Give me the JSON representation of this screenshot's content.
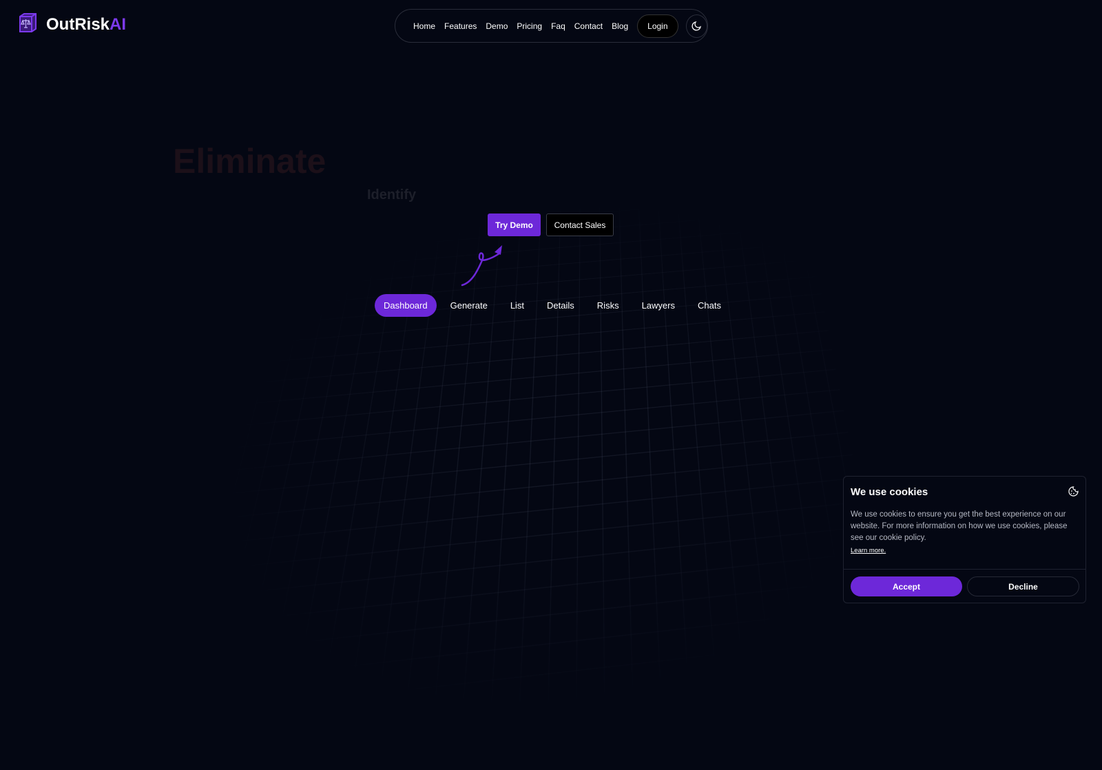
{
  "brand": {
    "name": "OutRisk",
    "accent": "AI"
  },
  "nav": {
    "items": [
      "Home",
      "Features",
      "Demo",
      "Pricing",
      "Faq",
      "Contact",
      "Blog"
    ],
    "login": "Login"
  },
  "hero": {
    "headline": "Eliminate",
    "subheadline": "Identify",
    "try_demo": "Try Demo",
    "contact_sales": "Contact Sales"
  },
  "tabs": [
    "Dashboard",
    "Generate",
    "List",
    "Details",
    "Risks",
    "Lawyers",
    "Chats"
  ],
  "cookie": {
    "title": "We use cookies",
    "body": "We use cookies to ensure you get the best experience on our website. For more information on how we use cookies, please see our cookie policy.",
    "learn_more": "Learn more.",
    "accept": "Accept",
    "decline": "Decline"
  },
  "colors": {
    "accent": "#6d28d9",
    "background": "#040713"
  }
}
